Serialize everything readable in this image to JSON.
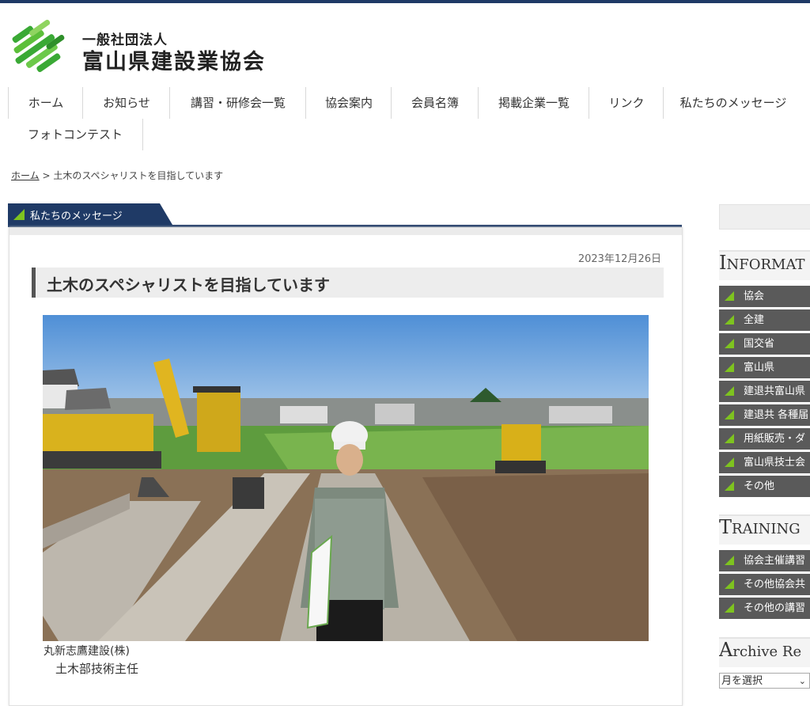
{
  "header": {
    "org_line1": "一般社団法人",
    "org_line2": "富山県建設業協会",
    "brand_color": "#3aa935",
    "logo_icon": "diagonal-stripes-logo"
  },
  "nav": {
    "items": [
      {
        "label": "ホーム"
      },
      {
        "label": "お知らせ"
      },
      {
        "label": "講習・研修会一覧"
      },
      {
        "label": "協会案内"
      },
      {
        "label": "会員名簿"
      },
      {
        "label": "掲載企業一覧"
      },
      {
        "label": "リンク"
      },
      {
        "label": "私たちのメッセージ"
      },
      {
        "label": "フォトコンテスト"
      }
    ]
  },
  "breadcrumb": {
    "home": "ホーム",
    "separator": " > ",
    "current": "土木のスペシャリストを目指しています"
  },
  "section": {
    "tab_label": "私たちのメッセージ",
    "accent_color": "#1f3a66",
    "arrow_color": "#7ec31f"
  },
  "post": {
    "date": "2023年12月26日",
    "title": "土木のスペシャリストを目指しています",
    "photo_icon": "construction-site-photo",
    "caption_company": "丸新志鷹建設(株)",
    "caption_role": "土木部技術主任"
  },
  "sidebar": {
    "information": {
      "cap": "I",
      "rest": "NFORMAT",
      "items": [
        {
          "label": "協会"
        },
        {
          "label": "全建"
        },
        {
          "label": "国交省"
        },
        {
          "label": "富山県"
        },
        {
          "label": "建退共富山県"
        },
        {
          "label": "建退共 各種届"
        },
        {
          "label": "用紙販売・ダ"
        },
        {
          "label": "富山県技士会"
        },
        {
          "label": "その他"
        }
      ]
    },
    "training": {
      "cap": "T",
      "rest": "RAINING",
      "items": [
        {
          "label": "協会主催講習"
        },
        {
          "label": "その他協会共"
        },
        {
          "label": "その他の講習"
        }
      ]
    },
    "archive": {
      "cap": "A",
      "rest": "rchive Re",
      "select_value": "月を選択"
    }
  }
}
